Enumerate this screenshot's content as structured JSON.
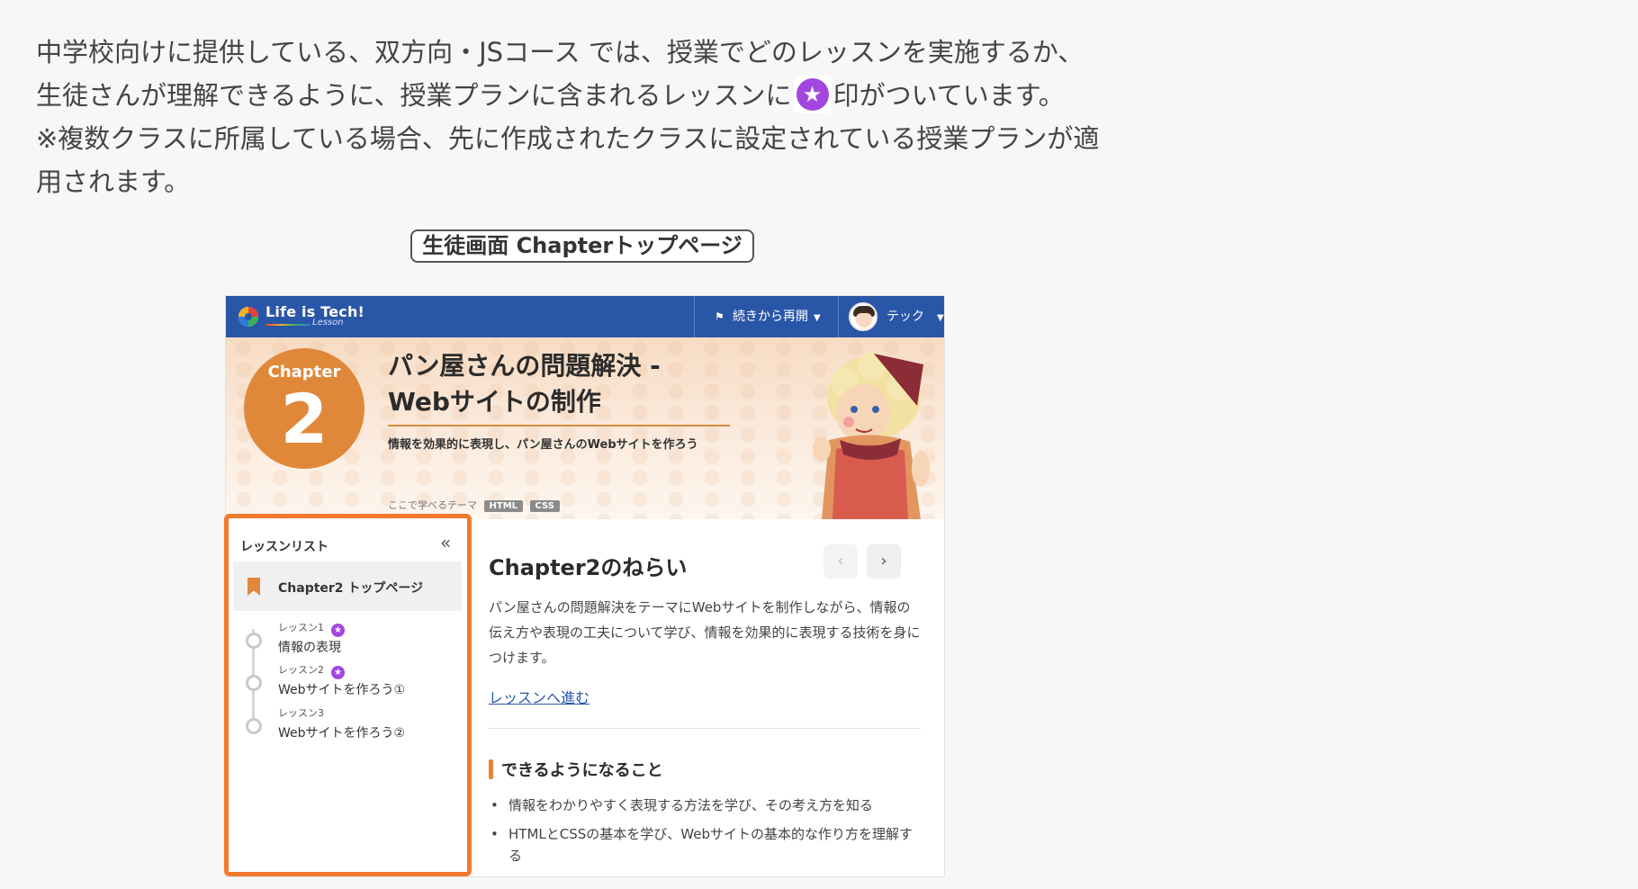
{
  "intro": {
    "line1": "中学校向けに提供している、双方向・JSコース では、授業でどのレッスンを実施するか、",
    "line2_before": "生徒さんが理解できるように、授業プランに含まれるレッスンに",
    "line2_after": "印がついています。",
    "line3": "※複数クラスに所属している場合、先に作成されたクラスに設定されている授業プランが適",
    "line4": "用されます。"
  },
  "caption": "生徒画面 Chapterトップページ",
  "topbar": {
    "logo_text": "Life is Tech!",
    "logo_sub": "Lesson",
    "resume_label": "続きから再開",
    "user_name": "テック"
  },
  "hero": {
    "chapter_label": "Chapter",
    "chapter_number": "2",
    "title_line1": "パン屋さんの問題解決 -",
    "title_line2": "Webサイトの制作",
    "description": "情報を効果的に表現し、パン屋さんのWebサイトを作ろう",
    "theme_label": "ここで学べるテーマ",
    "tags": [
      "HTML",
      "CSS"
    ]
  },
  "sidebar": {
    "title": "レッスンリスト",
    "current": "Chapter2 トップページ",
    "lessons": [
      {
        "number": "レッスン1",
        "name": "情報の表現",
        "starred": true
      },
      {
        "number": "レッスン2",
        "name": "Webサイトを作ろう①",
        "starred": true
      },
      {
        "number": "レッスン3",
        "name": "Webサイトを作ろう②",
        "starred": false
      }
    ]
  },
  "main": {
    "title": "Chapter2のねらい",
    "body": "パン屋さんの問題解決をテーマにWebサイトを制作しながら、情報の伝え方や表現の工夫について学び、情報を効果的に表現する技術を身につけます。",
    "link": "レッスンへ進む",
    "can_heading": "できるようになること",
    "can_items": [
      "情報をわかりやすく表現する方法を学び、その考え方を知る",
      "HTMLとCSSの基本を学び、Webサイトの基本的な作り方を理解する"
    ]
  },
  "colors": {
    "topbar": "#2a56a8",
    "accent_orange": "#e0883a",
    "highlight": "#f07a2e",
    "star_purple": "#a346e0"
  }
}
